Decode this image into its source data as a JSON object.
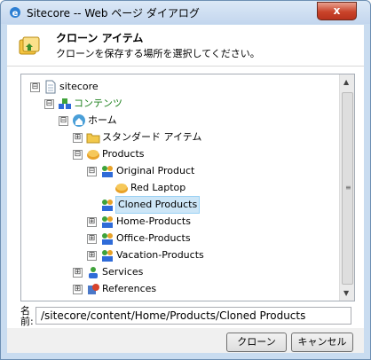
{
  "window": {
    "title": "Sitecore -- Web ページ ダイアログ",
    "close_label": "x"
  },
  "header": {
    "title": "クローン アイテム",
    "subtitle": "クローンを保存する場所を選択してください。"
  },
  "tree": {
    "items": [
      {
        "label": "sitecore",
        "toggle": "⊟",
        "icon": "document-icon"
      },
      {
        "label": "コンテンツ",
        "toggle": "⊟",
        "icon": "content-icon",
        "color": "#1a7f1a"
      },
      {
        "label": "ホーム",
        "toggle": "⊟",
        "icon": "home-icon"
      },
      {
        "label": "スタンダード アイテム",
        "toggle": "⊞",
        "icon": "folder-icon"
      },
      {
        "label": "Products",
        "toggle": "⊟",
        "icon": "products-icon"
      },
      {
        "label": "Original Product",
        "toggle": "⊟",
        "icon": "product-group-icon"
      },
      {
        "label": "Red Laptop",
        "toggle": "",
        "icon": "laptop-icon"
      },
      {
        "label": "Cloned Products",
        "toggle": "",
        "icon": "product-group-icon",
        "selected": true
      },
      {
        "label": "Home-Products",
        "toggle": "⊞",
        "icon": "product-group-icon"
      },
      {
        "label": "Office-Products",
        "toggle": "⊞",
        "icon": "product-group-icon"
      },
      {
        "label": "Vacation-Products",
        "toggle": "⊞",
        "icon": "product-group-icon"
      },
      {
        "label": "Services",
        "toggle": "⊞",
        "icon": "services-icon"
      },
      {
        "label": "References",
        "toggle": "⊞",
        "icon": "references-icon"
      }
    ]
  },
  "name_field": {
    "label": "名前:",
    "value": "/sitecore/content/Home/Products/Cloned Products"
  },
  "buttons": {
    "clone": "クローン",
    "cancel": "キャンセル"
  },
  "colors": {
    "selection_bg": "#cde6f7",
    "selection_border": "#99d1f4",
    "close_button": "#c9432a"
  }
}
